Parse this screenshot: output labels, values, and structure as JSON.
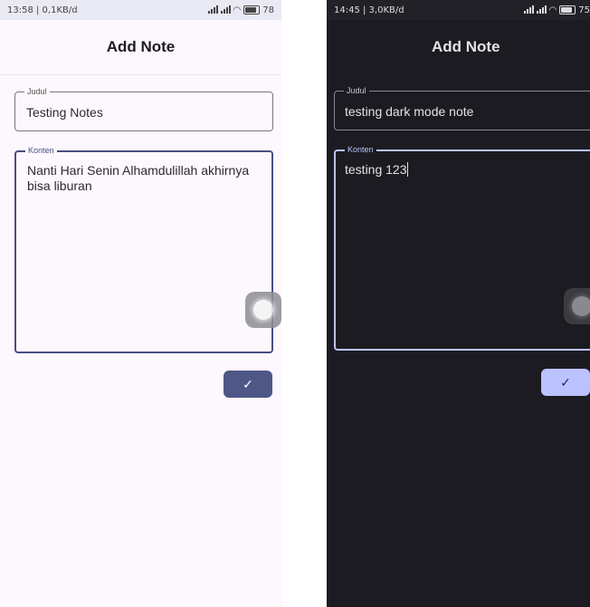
{
  "light": {
    "status_left": "13:58 | 0,1KB/d",
    "status_battery": "78",
    "title": "Add Note",
    "title_field": {
      "label": "Judul",
      "value": "Testing Notes"
    },
    "content_field": {
      "label": "Konten",
      "value": "Nanti Hari Senin Alhamdulillah akhirnya\nbisa liburan"
    },
    "save_icon": "✓"
  },
  "dark": {
    "status_left": "14:45 | 3,0KB/d",
    "status_battery": "75",
    "title": "Add Note",
    "title_field": {
      "label": "Judul",
      "value": "testing dark mode note"
    },
    "content_field": {
      "label": "Konten",
      "value": "testing 123"
    },
    "save_icon": "✓"
  },
  "colors": {
    "light_bg": "#fdf8fd",
    "dark_bg": "#1c1b21",
    "light_accent": "#4f5787",
    "dark_accent": "#bcc2ff"
  }
}
